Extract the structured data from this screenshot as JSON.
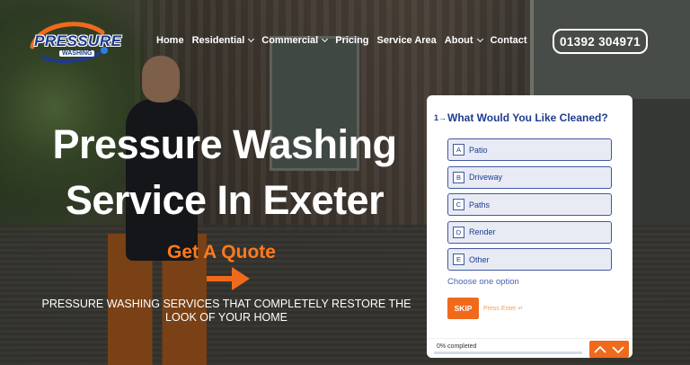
{
  "brand": {
    "logo_text": "PRESSURE",
    "logo_sub": "WASHING",
    "accent": "#f06a1c",
    "navy": "#1f3c8f"
  },
  "nav": {
    "items": [
      {
        "label": "Home"
      },
      {
        "label": "Residential"
      },
      {
        "label": "Commercial"
      },
      {
        "label": "Pricing"
      },
      {
        "label": "Service Area"
      },
      {
        "label": "About"
      },
      {
        "label": "Contact"
      }
    ],
    "phone": "01392 304971"
  },
  "hero": {
    "title_line1": "Pressure Washing",
    "title_line2": "Service In Exeter",
    "cta": "Get A Quote",
    "subtitle": "PRESSURE WASHING SERVICES THAT COMPLETELY RESTORE THE LOOK OF YOUR HOME"
  },
  "form": {
    "question_number": "1→",
    "question": "What Would You Like Cleaned?",
    "options": [
      {
        "key": "A",
        "label": "Patio"
      },
      {
        "key": "B",
        "label": "Driveway"
      },
      {
        "key": "C",
        "label": "Paths"
      },
      {
        "key": "D",
        "label": "Render"
      },
      {
        "key": "E",
        "label": "Other"
      }
    ],
    "hint": "Choose one option",
    "skip": "SKIP",
    "press_enter": "Press Enter ↵",
    "progress_text": "0% completed",
    "progress_fraction": 0
  }
}
